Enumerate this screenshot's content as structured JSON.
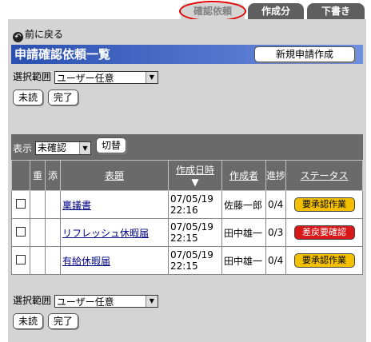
{
  "tabs": [
    {
      "label": "確認依頼",
      "active": true
    },
    {
      "label": "作成分",
      "active": false
    },
    {
      "label": "下書き",
      "active": false
    }
  ],
  "back_label": "前に戻る",
  "title": "申請確認依頼一覧",
  "new_request_label": "新規申請作成",
  "scope": {
    "label": "選択範囲",
    "value": "ユーザー任意"
  },
  "buttons": {
    "unread": "未読",
    "done": "完了"
  },
  "list": {
    "display_label": "表示",
    "display_value": "未確認",
    "switch_label": "切替",
    "columns": {
      "heavy": "重",
      "attach": "添",
      "subject": "表題",
      "created": "作成日時",
      "sort_mark": "▼",
      "author": "作成者",
      "progress": "進捗",
      "status": "ステータス"
    },
    "rows": [
      {
        "subject": "稟議書",
        "date": "07/05/19",
        "time": "22:16",
        "author": "佐藤一郎",
        "progress": "0/4",
        "status": "要承認作業",
        "status_color": "#f2c000"
      },
      {
        "subject": "リフレッシュ休暇届",
        "date": "07/05/19",
        "time": "22:15",
        "author": "田中雄一",
        "progress": "0/3",
        "status": "差戻要確認",
        "status_color": "#d81818"
      },
      {
        "subject": "有給休暇届",
        "date": "07/05/19",
        "time": "22:15",
        "author": "田中雄一",
        "progress": "0/4",
        "status": "要承認作業",
        "status_color": "#f2c000"
      }
    ]
  },
  "colors": {
    "title_bar": "#2a4fb0",
    "panel": "#d4d4d4",
    "tab": "#5f5f5f",
    "highlight_ring": "#e00000"
  }
}
